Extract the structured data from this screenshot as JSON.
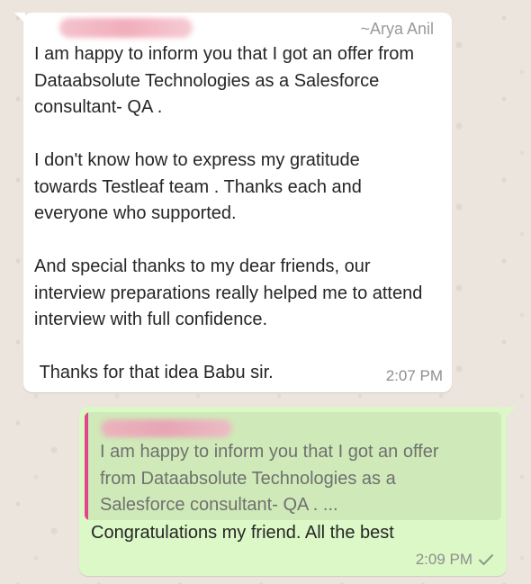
{
  "chat": {
    "incoming": {
      "push_name": "~Arya Anil",
      "text": "I am happy to inform you that I got an offer from\nDataabsolute Technologies as a Salesforce\nconsultant- QA .\n\nI don't know how to express my gratitude\ntowards Testleaf team . Thanks each and\neveryone who supported.\n\nAnd special thanks to my dear friends, our\ninterview preparations really helped me to attend\ninterview with full confidence.\n\n Thanks for that idea Babu sir.",
      "time": "2:07 PM"
    },
    "outgoing": {
      "quoted_text": "I am happy to inform you that I got an offer\nfrom Dataabsolute Technologies as a\nSalesforce consultant- QA . ...",
      "text": "Congratulations my friend. All the best",
      "time": "2:09 PM",
      "status_icon": "single-check-icon"
    }
  },
  "colors": {
    "wallpaper": "#ece5dd",
    "incoming_bubble": "#ffffff",
    "outgoing_bubble": "#dcf8c6",
    "quote_bar": "#e2458b"
  }
}
